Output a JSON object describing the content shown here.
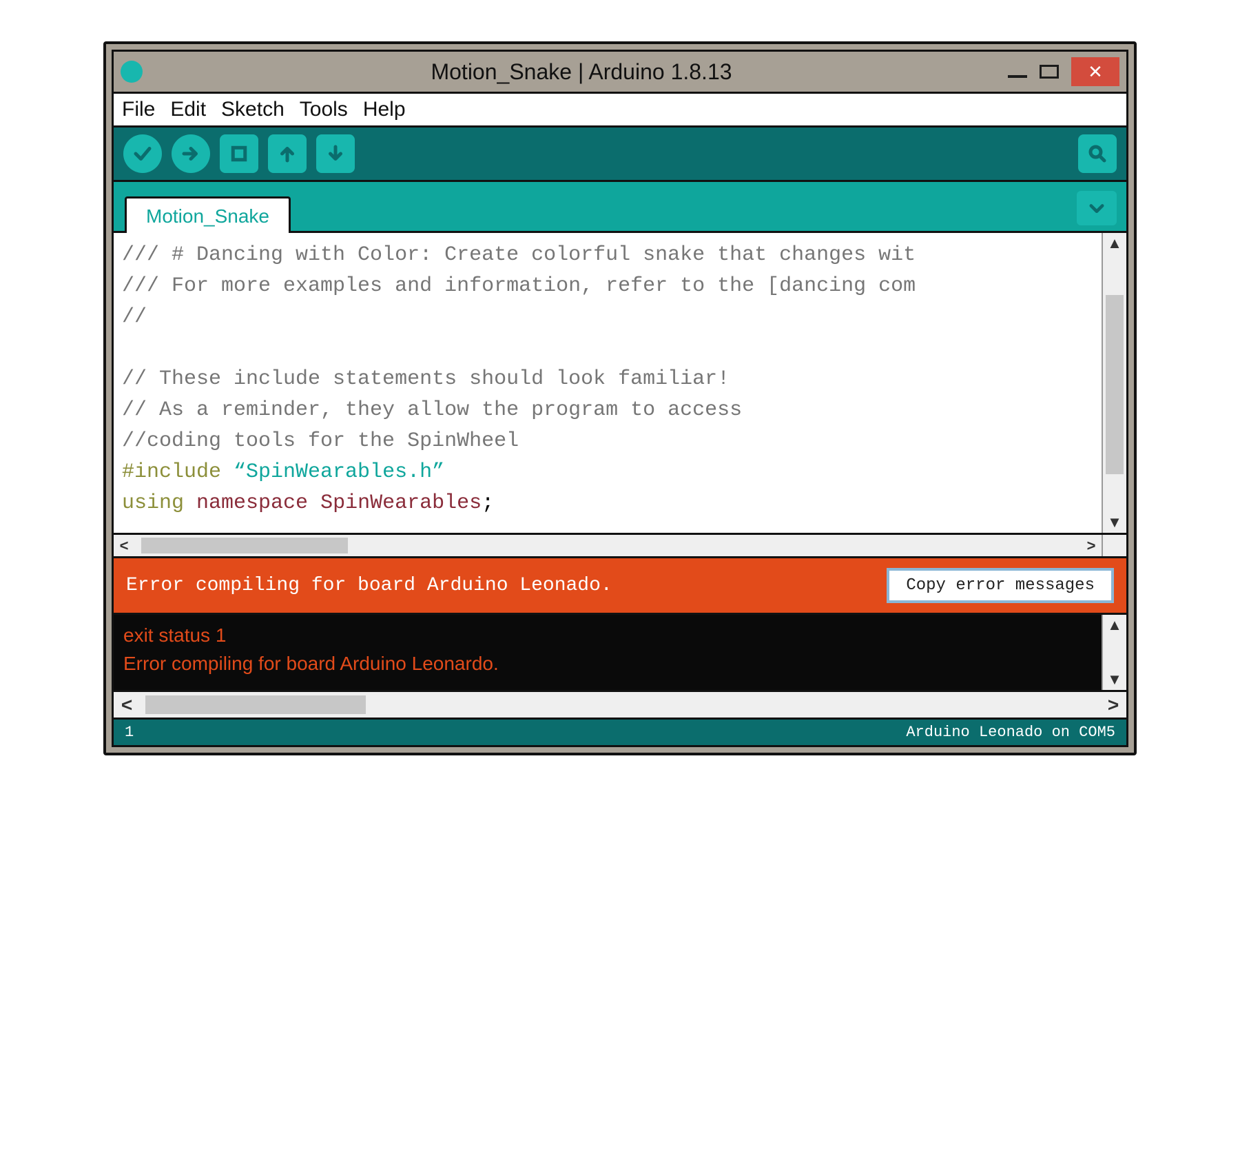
{
  "window": {
    "title": "Motion_Snake | Arduino 1.8.13"
  },
  "menu": {
    "items": [
      "File",
      "Edit",
      "Sketch",
      "Tools",
      "Help"
    ]
  },
  "toolbar": {
    "verify_icon": "verify",
    "upload_icon": "upload",
    "new_icon": "new",
    "open_icon": "open",
    "save_icon": "save",
    "serial_icon": "serial-monitor"
  },
  "tabs": {
    "active": "Motion_Snake"
  },
  "editor": {
    "lines": [
      {
        "t": "cmt",
        "s": "/// # Dancing with Color: Create colorful snake that changes wit"
      },
      {
        "t": "cmt",
        "s": "/// For more examples and information, refer to the [dancing com"
      },
      {
        "t": "cmt",
        "s": "//"
      },
      {
        "t": "blank",
        "s": ""
      },
      {
        "t": "cmt",
        "s": "// These include statements should look familiar!"
      },
      {
        "t": "cmt",
        "s": "// As a reminder, they allow the program to access"
      },
      {
        "t": "cmt",
        "s": "//coding tools for the SpinWheel"
      },
      {
        "t": "inc",
        "s": "#include “SpinWearables.h”"
      },
      {
        "t": "ns",
        "s": "using namespace SpinWearables;"
      }
    ]
  },
  "error_banner": {
    "message": "Error compiling for board Arduino Leonado.",
    "button": "Copy error messages"
  },
  "console": {
    "lines": [
      "exit status 1",
      "Error compiling for board Arduino Leonardo."
    ]
  },
  "footer": {
    "left": "1",
    "right": "Arduino Leonado on COM5"
  },
  "colors": {
    "teal_dark": "#0b6d6d",
    "teal": "#0fa69c",
    "teal_light": "#18b7ae",
    "orange": "#e24b1a",
    "close_red": "#d34c3d"
  }
}
